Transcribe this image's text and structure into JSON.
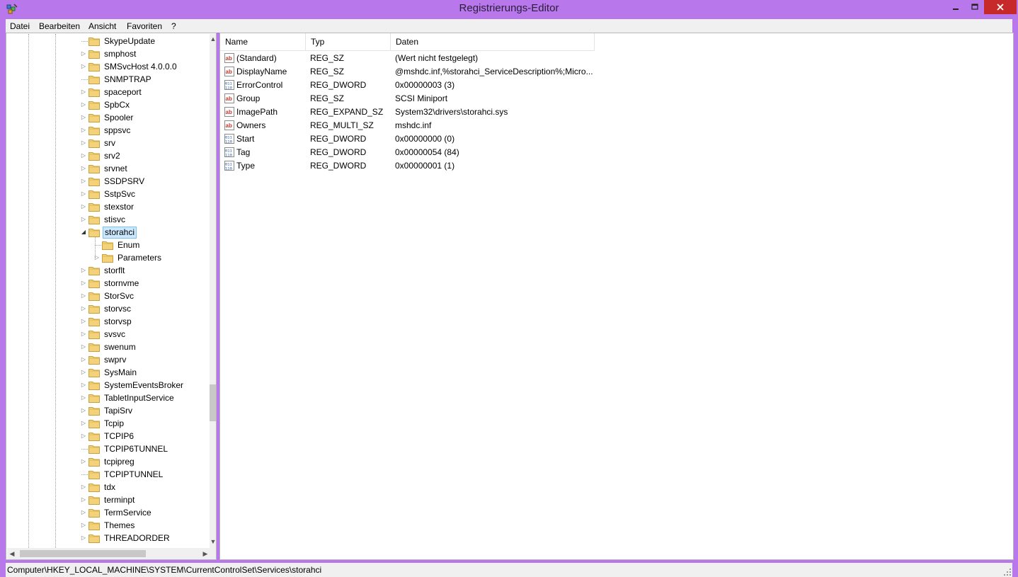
{
  "window": {
    "title": "Registrierungs-Editor"
  },
  "menu": [
    "Datei",
    "Bearbeiten",
    "Ansicht",
    "Favoriten",
    "?"
  ],
  "tree": [
    {
      "label": "SkypeUpdate",
      "expander": "none",
      "depth": 1
    },
    {
      "label": "smphost",
      "expander": "collapsed",
      "depth": 1
    },
    {
      "label": "SMSvcHost 4.0.0.0",
      "expander": "collapsed",
      "depth": 1
    },
    {
      "label": "SNMPTRAP",
      "expander": "none",
      "depth": 1
    },
    {
      "label": "spaceport",
      "expander": "collapsed",
      "depth": 1
    },
    {
      "label": "SpbCx",
      "expander": "collapsed",
      "depth": 1
    },
    {
      "label": "Spooler",
      "expander": "collapsed",
      "depth": 1
    },
    {
      "label": "sppsvc",
      "expander": "collapsed",
      "depth": 1
    },
    {
      "label": "srv",
      "expander": "collapsed",
      "depth": 1
    },
    {
      "label": "srv2",
      "expander": "collapsed",
      "depth": 1
    },
    {
      "label": "srvnet",
      "expander": "collapsed",
      "depth": 1
    },
    {
      "label": "SSDPSRV",
      "expander": "collapsed",
      "depth": 1
    },
    {
      "label": "SstpSvc",
      "expander": "collapsed",
      "depth": 1
    },
    {
      "label": "stexstor",
      "expander": "collapsed",
      "depth": 1
    },
    {
      "label": "stisvc",
      "expander": "collapsed",
      "depth": 1
    },
    {
      "label": "storahci",
      "expander": "expanded",
      "depth": 1,
      "selected": true
    },
    {
      "label": "Enum",
      "expander": "none",
      "depth": 2
    },
    {
      "label": "Parameters",
      "expander": "collapsed",
      "depth": 2
    },
    {
      "label": "storflt",
      "expander": "collapsed",
      "depth": 1
    },
    {
      "label": "stornvme",
      "expander": "collapsed",
      "depth": 1
    },
    {
      "label": "StorSvc",
      "expander": "collapsed",
      "depth": 1
    },
    {
      "label": "storvsc",
      "expander": "collapsed",
      "depth": 1
    },
    {
      "label": "storvsp",
      "expander": "collapsed",
      "depth": 1
    },
    {
      "label": "svsvc",
      "expander": "collapsed",
      "depth": 1
    },
    {
      "label": "swenum",
      "expander": "collapsed",
      "depth": 1
    },
    {
      "label": "swprv",
      "expander": "collapsed",
      "depth": 1
    },
    {
      "label": "SysMain",
      "expander": "collapsed",
      "depth": 1
    },
    {
      "label": "SystemEventsBroker",
      "expander": "collapsed",
      "depth": 1
    },
    {
      "label": "TabletInputService",
      "expander": "collapsed",
      "depth": 1
    },
    {
      "label": "TapiSrv",
      "expander": "collapsed",
      "depth": 1
    },
    {
      "label": "Tcpip",
      "expander": "collapsed",
      "depth": 1
    },
    {
      "label": "TCPIP6",
      "expander": "collapsed",
      "depth": 1
    },
    {
      "label": "TCPIP6TUNNEL",
      "expander": "none",
      "depth": 1
    },
    {
      "label": "tcpipreg",
      "expander": "collapsed",
      "depth": 1
    },
    {
      "label": "TCPIPTUNNEL",
      "expander": "none",
      "depth": 1
    },
    {
      "label": "tdx",
      "expander": "collapsed",
      "depth": 1
    },
    {
      "label": "terminpt",
      "expander": "collapsed",
      "depth": 1
    },
    {
      "label": "TermService",
      "expander": "collapsed",
      "depth": 1
    },
    {
      "label": "Themes",
      "expander": "collapsed",
      "depth": 1
    },
    {
      "label": "THREADORDER",
      "expander": "collapsed",
      "depth": 1
    }
  ],
  "list": {
    "columns": [
      "Name",
      "Typ",
      "Daten"
    ],
    "rows": [
      {
        "icon": "string-value-icon",
        "name": "(Standard)",
        "type": "REG_SZ",
        "data": "(Wert nicht festgelegt)"
      },
      {
        "icon": "string-value-icon",
        "name": "DisplayName",
        "type": "REG_SZ",
        "data": "@mshdc.inf,%storahci_ServiceDescription%;Micro..."
      },
      {
        "icon": "binary-value-icon",
        "name": "ErrorControl",
        "type": "REG_DWORD",
        "data": "0x00000003 (3)"
      },
      {
        "icon": "string-value-icon",
        "name": "Group",
        "type": "REG_SZ",
        "data": "SCSI Miniport"
      },
      {
        "icon": "string-value-icon",
        "name": "ImagePath",
        "type": "REG_EXPAND_SZ",
        "data": "System32\\drivers\\storahci.sys"
      },
      {
        "icon": "string-value-icon",
        "name": "Owners",
        "type": "REG_MULTI_SZ",
        "data": "mshdc.inf"
      },
      {
        "icon": "binary-value-icon",
        "name": "Start",
        "type": "REG_DWORD",
        "data": "0x00000000 (0)"
      },
      {
        "icon": "binary-value-icon",
        "name": "Tag",
        "type": "REG_DWORD",
        "data": "0x00000054 (84)"
      },
      {
        "icon": "binary-value-icon",
        "name": "Type",
        "type": "REG_DWORD",
        "data": "0x00000001 (1)"
      }
    ]
  },
  "status": {
    "path": "Computer\\HKEY_LOCAL_MACHINE\\SYSTEM\\CurrentControlSet\\Services\\storahci"
  },
  "colors": {
    "titlebar": "#b878ec",
    "close": "#c7292a",
    "selection": "#cce8ff"
  }
}
